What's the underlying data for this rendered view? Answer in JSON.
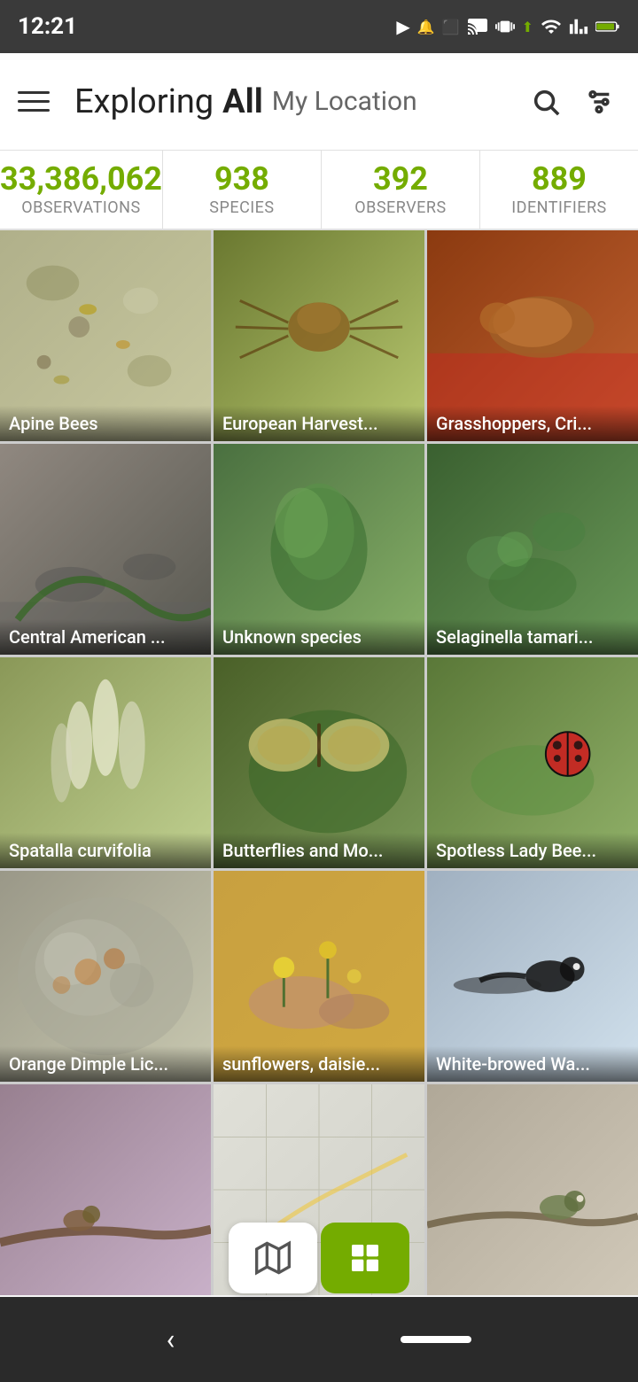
{
  "statusBar": {
    "time": "12:21",
    "icons": [
      "play",
      "notification",
      "screenshot",
      "cast",
      "vibrate",
      "signal",
      "wifi",
      "network",
      "battery"
    ]
  },
  "header": {
    "title_exploring": "Exploring",
    "title_all": "All",
    "title_location": "My Location",
    "menu_label": "Menu",
    "search_label": "Search",
    "filter_label": "Filter"
  },
  "stats": [
    {
      "value": "33,386,062",
      "label": "OBSERVATIONS"
    },
    {
      "value": "938",
      "label": "SPECIES"
    },
    {
      "value": "392",
      "label": "OBSERVERS"
    },
    {
      "value": "889",
      "label": "IDENTIFIERS"
    }
  ],
  "grid": [
    {
      "label": "Apine Bees",
      "bg": "bees"
    },
    {
      "label": "European Harvest...",
      "bg": "spider"
    },
    {
      "label": "Grasshoppers, Cri...",
      "bg": "grasshopper"
    },
    {
      "label": "Central American ...",
      "bg": "central"
    },
    {
      "label": "Unknown species",
      "bg": "unknown"
    },
    {
      "label": "Selaginella tamari...",
      "bg": "selaginella"
    },
    {
      "label": "Spatalla curvifolia",
      "bg": "spatalla"
    },
    {
      "label": "Butterflies and Mo...",
      "bg": "butterflies"
    },
    {
      "label": "Spotless Lady Bee...",
      "bg": "ladybee"
    },
    {
      "label": "Orange Dimple Lic...",
      "bg": "lichen"
    },
    {
      "label": "sunflowers, daisie...",
      "bg": "sunflowers"
    },
    {
      "label": "White-browed Wa...",
      "bg": "wagtail"
    },
    {
      "label": "",
      "bg": "bird1"
    },
    {
      "label": "",
      "bg": "map"
    },
    {
      "label": "",
      "bg": "bird2"
    }
  ],
  "toolbar": {
    "map_label": "Map view",
    "grid_label": "Grid view"
  }
}
